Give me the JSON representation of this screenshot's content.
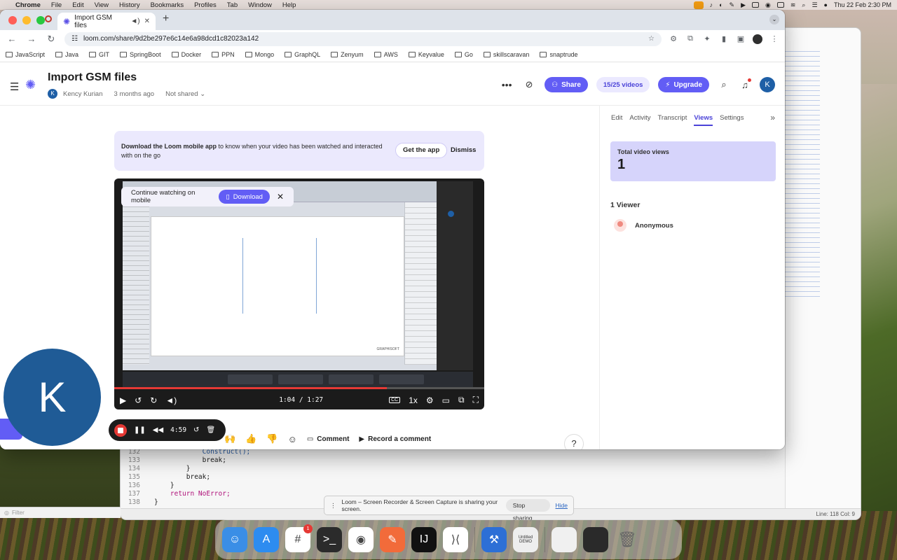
{
  "menubar": {
    "app": "Chrome",
    "items": [
      "File",
      "Edit",
      "View",
      "History",
      "Bookmarks",
      "Profiles",
      "Tab",
      "Window",
      "Help"
    ],
    "clock": "Thu 22 Feb  2:30 PM"
  },
  "browser": {
    "tab_title": "Import GSM files",
    "url": "loom.com/share/9d2be297e6c14e6a98dcd1c82023a142",
    "bookmarks": [
      "JavaScript",
      "Java",
      "GIT",
      "SpringBoot",
      "Docker",
      "PPN",
      "Mongo",
      "GraphQL",
      "Zenyum",
      "AWS",
      "Keyvalue",
      "Go",
      "skillscaravan",
      "snaptrude"
    ]
  },
  "loom": {
    "title": "Import GSM files",
    "author_initial": "K",
    "author": "Kency Kurian",
    "age": "3 months ago",
    "sharing": "Not shared",
    "share_label": "Share",
    "video_count": "15/25 videos",
    "upgrade_label": "Upgrade",
    "user_initial": "K"
  },
  "banner": {
    "bold": "Download the Loom mobile app",
    "text": " to know when your video has been watched and interacted with on the go",
    "get_app": "Get the app",
    "dismiss": "Dismiss"
  },
  "player": {
    "mobile_prompt": "Continue watching on mobile",
    "download_label": "Download",
    "watermark": "GRAPHISOFT",
    "time": "1:04 / 1:27",
    "progress_fraction": 0.736,
    "speed": "1x",
    "cc": "CC"
  },
  "reactions": {
    "comment_label": "Comment",
    "record_label": "Record a comment",
    "help": "?"
  },
  "panel": {
    "tabs": [
      "Edit",
      "Activity",
      "Transcript",
      "Views",
      "Settings"
    ],
    "active_tab": "Views",
    "total_views_label": "Total video views",
    "total_views": "1",
    "viewers_heading": "1 Viewer",
    "viewer_name": "Anonymous"
  },
  "recorder": {
    "camera_initial": "K",
    "elapsed": "4:59"
  },
  "code": {
    "lines": [
      {
        "n": "132",
        "indent": "            ",
        "text": "Construct();",
        "kind": "fn"
      },
      {
        "n": "133",
        "indent": "            ",
        "text": "break;",
        "kind": "plain"
      },
      {
        "n": "134",
        "indent": "        ",
        "text": "}",
        "kind": "plain"
      },
      {
        "n": "135",
        "indent": "        ",
        "text": "break;",
        "kind": "plain"
      },
      {
        "n": "136",
        "indent": "    ",
        "text": "}",
        "kind": "plain"
      },
      {
        "n": "137",
        "indent": "    ",
        "text": "return NoError;",
        "kind": "ret"
      },
      {
        "n": "138",
        "indent": "",
        "text": "}",
        "kind": "plain"
      }
    ],
    "filter_placeholder": "Filter",
    "status": "Line: 118  Col: 9"
  },
  "share_note": {
    "text": "Loom – Screen Recorder & Screen Capture is sharing your screen.",
    "stop": "Stop sharing",
    "hide": "Hide"
  },
  "dock": {
    "apps": [
      {
        "name": "finder-icon",
        "color": "#3a8ee6",
        "glyph": "☺"
      },
      {
        "name": "app-store-icon",
        "color": "#2d8cf0",
        "glyph": "A"
      },
      {
        "name": "slack-icon",
        "color": "#ffffff",
        "glyph": "#",
        "badge": "1"
      },
      {
        "name": "terminal-icon",
        "color": "#2b2b2b",
        "glyph": ">_"
      },
      {
        "name": "chrome-icon",
        "color": "#ffffff",
        "glyph": "◉"
      },
      {
        "name": "pen-tool-icon",
        "color": "#f26b3a",
        "glyph": "✎"
      },
      {
        "name": "intellij-icon",
        "color": "#111111",
        "glyph": "IJ"
      },
      {
        "name": "vscode-icon",
        "color": "#ffffff",
        "glyph": "⟩⟨"
      }
    ],
    "untitled_label": "Untitled",
    "demo_label": "DEMO"
  },
  "colors": {
    "loom_purple": "#625df5",
    "views_card": "#d6d4fb",
    "record_red": "#e53935"
  }
}
